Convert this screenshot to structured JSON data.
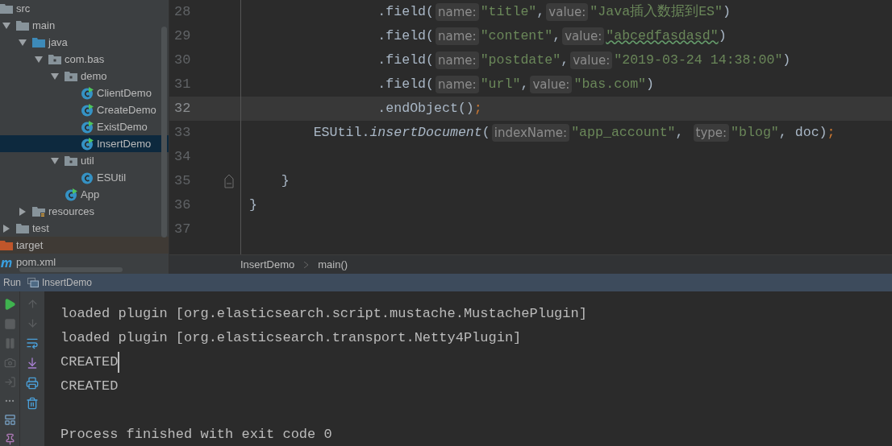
{
  "project_tree": [
    {
      "name": "src",
      "kind": "folder",
      "selected": false,
      "children": [
        {
          "name": "main",
          "kind": "folder",
          "expanded": true,
          "selected": false,
          "children": [
            {
              "name": "java",
              "kind": "source_folder",
              "expanded": true,
              "selected": false,
              "children": [
                {
                  "name": "com.bas",
                  "kind": "package",
                  "expanded": true,
                  "selected": false,
                  "children": [
                    {
                      "name": "demo",
                      "kind": "package",
                      "expanded": true,
                      "selected": false,
                      "children": [
                        {
                          "name": "ClientDemo",
                          "kind": "class",
                          "runnable": true,
                          "selected": false
                        },
                        {
                          "name": "CreateDemo",
                          "kind": "class",
                          "runnable": true,
                          "selected": false
                        },
                        {
                          "name": "ExistDemo",
                          "kind": "class",
                          "runnable": true,
                          "selected": false
                        },
                        {
                          "name": "InsertDemo",
                          "kind": "class",
                          "runnable": true,
                          "selected": true
                        }
                      ]
                    },
                    {
                      "name": "util",
                      "kind": "package",
                      "expanded": true,
                      "selected": false,
                      "children": [
                        {
                          "name": "ESUtil",
                          "kind": "class",
                          "runnable": false,
                          "selected": false
                        }
                      ]
                    },
                    {
                      "name": "App",
                      "kind": "class",
                      "runnable": true,
                      "selected": false
                    }
                  ]
                }
              ]
            },
            {
              "name": "resources",
              "kind": "resources_folder",
              "expanded": false,
              "selected": false
            }
          ]
        },
        {
          "name": "test",
          "kind": "folder",
          "expanded": false,
          "selected": false
        }
      ]
    },
    {
      "name": "target",
      "kind": "excluded_folder",
      "selected": false
    },
    {
      "name": "pom.xml",
      "kind": "maven_file",
      "selected": false
    }
  ],
  "editor": {
    "lines": [
      {
        "number": "28",
        "current": false,
        "segments": [
          {
            "kind": "code",
            "text": "                .field("
          },
          {
            "kind": "hint",
            "text": "name:"
          },
          {
            "kind": "string",
            "text": "\"title\""
          },
          {
            "kind": "code",
            "text": ","
          },
          {
            "kind": "hint",
            "text": "value:"
          },
          {
            "kind": "string",
            "text": "\"Java插入数据到ES\""
          },
          {
            "kind": "code",
            "text": ")"
          }
        ]
      },
      {
        "number": "29",
        "current": false,
        "segments": [
          {
            "kind": "code",
            "text": "                .field("
          },
          {
            "kind": "hint",
            "text": "name:"
          },
          {
            "kind": "string",
            "text": "\"content\""
          },
          {
            "kind": "code",
            "text": ","
          },
          {
            "kind": "hint",
            "text": "value:"
          },
          {
            "kind": "typo",
            "text": "\"abcedfasdasd\""
          },
          {
            "kind": "code",
            "text": ")"
          }
        ]
      },
      {
        "number": "30",
        "current": false,
        "segments": [
          {
            "kind": "code",
            "text": "                .field("
          },
          {
            "kind": "hint",
            "text": "name:"
          },
          {
            "kind": "string",
            "text": "\"postdate\""
          },
          {
            "kind": "code",
            "text": ","
          },
          {
            "kind": "hint",
            "text": "value:"
          },
          {
            "kind": "string",
            "text": "\"2019-03-24 14:38:00\""
          },
          {
            "kind": "code",
            "text": ")"
          }
        ]
      },
      {
        "number": "31",
        "current": false,
        "segments": [
          {
            "kind": "code",
            "text": "                .field("
          },
          {
            "kind": "hint",
            "text": "name:"
          },
          {
            "kind": "string",
            "text": "\"url\""
          },
          {
            "kind": "code",
            "text": ","
          },
          {
            "kind": "hint",
            "text": "value:"
          },
          {
            "kind": "string",
            "text": "\"bas.com\""
          },
          {
            "kind": "code",
            "text": ")"
          }
        ]
      },
      {
        "number": "32",
        "current": true,
        "segments": [
          {
            "kind": "code",
            "text": "                .endObject()"
          },
          {
            "kind": "punct",
            "text": ";"
          }
        ]
      },
      {
        "number": "33",
        "current": false,
        "segments": [
          {
            "kind": "code",
            "text": "        ESUtil."
          },
          {
            "kind": "call",
            "text": "insertDocument"
          },
          {
            "kind": "code",
            "text": "("
          },
          {
            "kind": "hint",
            "text": "indexName:"
          },
          {
            "kind": "string",
            "text": "\"app_account\""
          },
          {
            "kind": "code",
            "text": ", "
          },
          {
            "kind": "hint",
            "text": "type:"
          },
          {
            "kind": "string",
            "text": "\"blog\""
          },
          {
            "kind": "code",
            "text": ", doc)"
          },
          {
            "kind": "punct",
            "text": ";"
          }
        ]
      },
      {
        "number": "34",
        "current": false
      },
      {
        "number": "35",
        "current": false,
        "fold": true,
        "segments": [
          {
            "kind": "code",
            "text": "    }"
          }
        ]
      },
      {
        "number": "36",
        "current": false,
        "segments": [
          {
            "kind": "code",
            "text": "}"
          }
        ]
      },
      {
        "number": "37",
        "current": false
      }
    ],
    "breadcrumbs": [
      "InsertDemo",
      "main()"
    ]
  },
  "run_panel": {
    "label": "Run",
    "tab": "InsertDemo",
    "console_lines": [
      {
        "kind": "output",
        "text": "loaded plugin [org.elasticsearch.script.mustache.MustachePlugin]",
        "cursor": false
      },
      {
        "kind": "output",
        "text": "loaded plugin [org.elasticsearch.transport.Netty4Plugin]",
        "cursor": false
      },
      {
        "kind": "output",
        "text": "CREATED",
        "cursor": true
      },
      {
        "kind": "output",
        "text": "CREATED",
        "cursor": false
      },
      {
        "kind": "exit",
        "text": "Process finished with exit code 0",
        "cursor": false
      }
    ]
  }
}
